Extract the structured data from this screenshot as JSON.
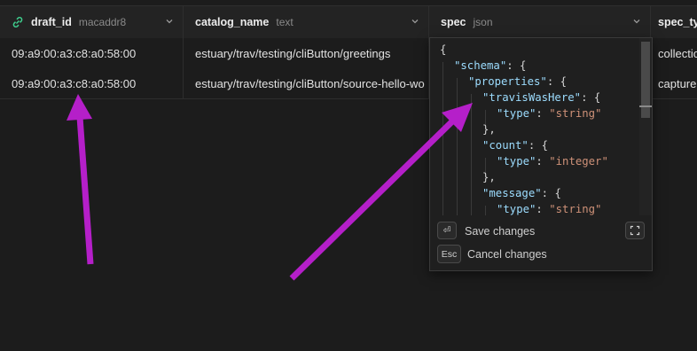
{
  "header": {
    "columns": [
      {
        "name": "draft_id",
        "type": "macaddr8"
      },
      {
        "name": "catalog_name",
        "type": "text"
      },
      {
        "name": "spec",
        "type": "json"
      },
      {
        "name": "spec_ty",
        "type": ""
      }
    ]
  },
  "rows": [
    {
      "draft_id": "09:a9:00:a3:c8:a0:58:00",
      "catalog_name": "estuary/trav/testing/cliButton/greetings",
      "spec_ty": "collectio"
    },
    {
      "draft_id": "09:a9:00:a3:c8:a0:58:00",
      "catalog_name": "estuary/trav/testing/cliButton/source-hello-wo",
      "spec_ty": "capture"
    }
  ],
  "editor": {
    "lines": [
      {
        "parts": [
          {
            "t": "{",
            "c": "p"
          }
        ]
      },
      {
        "parts": [
          {
            "t": "\"schema\"",
            "c": "k"
          },
          {
            "t": ": {",
            "c": "p"
          }
        ]
      },
      {
        "parts": [
          {
            "t": "\"properties\"",
            "c": "k"
          },
          {
            "t": ": {",
            "c": "p"
          }
        ]
      },
      {
        "parts": [
          {
            "t": "\"travisWasHere\"",
            "c": "k"
          },
          {
            "t": ": {",
            "c": "p"
          }
        ]
      },
      {
        "parts": [
          {
            "t": "\"type\"",
            "c": "k"
          },
          {
            "t": ": ",
            "c": "p"
          },
          {
            "t": "\"string\"",
            "c": "s"
          }
        ]
      },
      {
        "parts": [
          {
            "t": "},",
            "c": "p"
          }
        ]
      },
      {
        "parts": [
          {
            "t": "\"count\"",
            "c": "k"
          },
          {
            "t": ": {",
            "c": "p"
          }
        ]
      },
      {
        "parts": [
          {
            "t": "\"type\"",
            "c": "k"
          },
          {
            "t": ": ",
            "c": "p"
          },
          {
            "t": "\"integer\"",
            "c": "s"
          }
        ]
      },
      {
        "parts": [
          {
            "t": "},",
            "c": "p"
          }
        ]
      },
      {
        "parts": [
          {
            "t": "\"message\"",
            "c": "k"
          },
          {
            "t": ": {",
            "c": "p"
          }
        ]
      },
      {
        "parts": [
          {
            "t": "\"type\"",
            "c": "k"
          },
          {
            "t": ": ",
            "c": "p"
          },
          {
            "t": "\"string\"",
            "c": "s"
          }
        ]
      }
    ],
    "save_key": "⏎",
    "save_label": "Save changes",
    "cancel_key": "Esc",
    "cancel_label": "Cancel changes"
  },
  "icons": {
    "draft_id_column": "link-icon",
    "sort": "chevron-down-icon",
    "expand": "expand-icon"
  },
  "colors": {
    "annotation_arrow": "#b51fc9",
    "json_key": "#9cdcfe",
    "json_string": "#ce9178"
  }
}
